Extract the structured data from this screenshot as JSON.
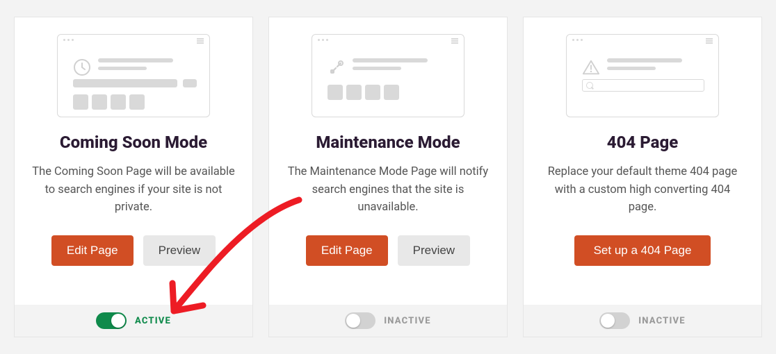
{
  "cards": [
    {
      "title": "Coming Soon Mode",
      "desc": "The Coming Soon Page will be available to search engines if your site is not private.",
      "primary_btn": "Edit Page",
      "secondary_btn": "Preview",
      "toggle_state": "on",
      "toggle_label": "ACTIVE"
    },
    {
      "title": "Maintenance Mode",
      "desc": "The Maintenance Mode Page will notify search engines that the site is unavailable.",
      "primary_btn": "Edit Page",
      "secondary_btn": "Preview",
      "toggle_state": "off",
      "toggle_label": "INACTIVE"
    },
    {
      "title": "404 Page",
      "desc": "Replace your default theme 404 page with a custom high converting 404 page.",
      "primary_btn": "Set up a 404 Page",
      "toggle_state": "off",
      "toggle_label": "INACTIVE"
    }
  ]
}
